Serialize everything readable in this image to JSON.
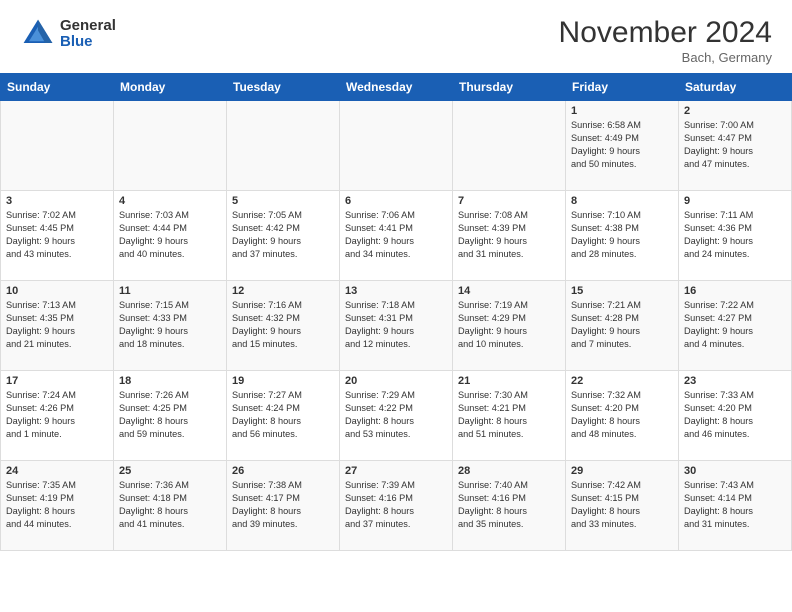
{
  "header": {
    "logo": {
      "line1": "General",
      "line2": "Blue"
    },
    "month": "November 2024",
    "location": "Bach, Germany"
  },
  "weekdays": [
    "Sunday",
    "Monday",
    "Tuesday",
    "Wednesday",
    "Thursday",
    "Friday",
    "Saturday"
  ],
  "weeks": [
    [
      {
        "day": "",
        "info": ""
      },
      {
        "day": "",
        "info": ""
      },
      {
        "day": "",
        "info": ""
      },
      {
        "day": "",
        "info": ""
      },
      {
        "day": "",
        "info": ""
      },
      {
        "day": "1",
        "info": "Sunrise: 6:58 AM\nSunset: 4:49 PM\nDaylight: 9 hours\nand 50 minutes."
      },
      {
        "day": "2",
        "info": "Sunrise: 7:00 AM\nSunset: 4:47 PM\nDaylight: 9 hours\nand 47 minutes."
      }
    ],
    [
      {
        "day": "3",
        "info": "Sunrise: 7:02 AM\nSunset: 4:45 PM\nDaylight: 9 hours\nand 43 minutes."
      },
      {
        "day": "4",
        "info": "Sunrise: 7:03 AM\nSunset: 4:44 PM\nDaylight: 9 hours\nand 40 minutes."
      },
      {
        "day": "5",
        "info": "Sunrise: 7:05 AM\nSunset: 4:42 PM\nDaylight: 9 hours\nand 37 minutes."
      },
      {
        "day": "6",
        "info": "Sunrise: 7:06 AM\nSunset: 4:41 PM\nDaylight: 9 hours\nand 34 minutes."
      },
      {
        "day": "7",
        "info": "Sunrise: 7:08 AM\nSunset: 4:39 PM\nDaylight: 9 hours\nand 31 minutes."
      },
      {
        "day": "8",
        "info": "Sunrise: 7:10 AM\nSunset: 4:38 PM\nDaylight: 9 hours\nand 28 minutes."
      },
      {
        "day": "9",
        "info": "Sunrise: 7:11 AM\nSunset: 4:36 PM\nDaylight: 9 hours\nand 24 minutes."
      }
    ],
    [
      {
        "day": "10",
        "info": "Sunrise: 7:13 AM\nSunset: 4:35 PM\nDaylight: 9 hours\nand 21 minutes."
      },
      {
        "day": "11",
        "info": "Sunrise: 7:15 AM\nSunset: 4:33 PM\nDaylight: 9 hours\nand 18 minutes."
      },
      {
        "day": "12",
        "info": "Sunrise: 7:16 AM\nSunset: 4:32 PM\nDaylight: 9 hours\nand 15 minutes."
      },
      {
        "day": "13",
        "info": "Sunrise: 7:18 AM\nSunset: 4:31 PM\nDaylight: 9 hours\nand 12 minutes."
      },
      {
        "day": "14",
        "info": "Sunrise: 7:19 AM\nSunset: 4:29 PM\nDaylight: 9 hours\nand 10 minutes."
      },
      {
        "day": "15",
        "info": "Sunrise: 7:21 AM\nSunset: 4:28 PM\nDaylight: 9 hours\nand 7 minutes."
      },
      {
        "day": "16",
        "info": "Sunrise: 7:22 AM\nSunset: 4:27 PM\nDaylight: 9 hours\nand 4 minutes."
      }
    ],
    [
      {
        "day": "17",
        "info": "Sunrise: 7:24 AM\nSunset: 4:26 PM\nDaylight: 9 hours\nand 1 minute."
      },
      {
        "day": "18",
        "info": "Sunrise: 7:26 AM\nSunset: 4:25 PM\nDaylight: 8 hours\nand 59 minutes."
      },
      {
        "day": "19",
        "info": "Sunrise: 7:27 AM\nSunset: 4:24 PM\nDaylight: 8 hours\nand 56 minutes."
      },
      {
        "day": "20",
        "info": "Sunrise: 7:29 AM\nSunset: 4:22 PM\nDaylight: 8 hours\nand 53 minutes."
      },
      {
        "day": "21",
        "info": "Sunrise: 7:30 AM\nSunset: 4:21 PM\nDaylight: 8 hours\nand 51 minutes."
      },
      {
        "day": "22",
        "info": "Sunrise: 7:32 AM\nSunset: 4:20 PM\nDaylight: 8 hours\nand 48 minutes."
      },
      {
        "day": "23",
        "info": "Sunrise: 7:33 AM\nSunset: 4:20 PM\nDaylight: 8 hours\nand 46 minutes."
      }
    ],
    [
      {
        "day": "24",
        "info": "Sunrise: 7:35 AM\nSunset: 4:19 PM\nDaylight: 8 hours\nand 44 minutes."
      },
      {
        "day": "25",
        "info": "Sunrise: 7:36 AM\nSunset: 4:18 PM\nDaylight: 8 hours\nand 41 minutes."
      },
      {
        "day": "26",
        "info": "Sunrise: 7:38 AM\nSunset: 4:17 PM\nDaylight: 8 hours\nand 39 minutes."
      },
      {
        "day": "27",
        "info": "Sunrise: 7:39 AM\nSunset: 4:16 PM\nDaylight: 8 hours\nand 37 minutes."
      },
      {
        "day": "28",
        "info": "Sunrise: 7:40 AM\nSunset: 4:16 PM\nDaylight: 8 hours\nand 35 minutes."
      },
      {
        "day": "29",
        "info": "Sunrise: 7:42 AM\nSunset: 4:15 PM\nDaylight: 8 hours\nand 33 minutes."
      },
      {
        "day": "30",
        "info": "Sunrise: 7:43 AM\nSunset: 4:14 PM\nDaylight: 8 hours\nand 31 minutes."
      }
    ]
  ]
}
